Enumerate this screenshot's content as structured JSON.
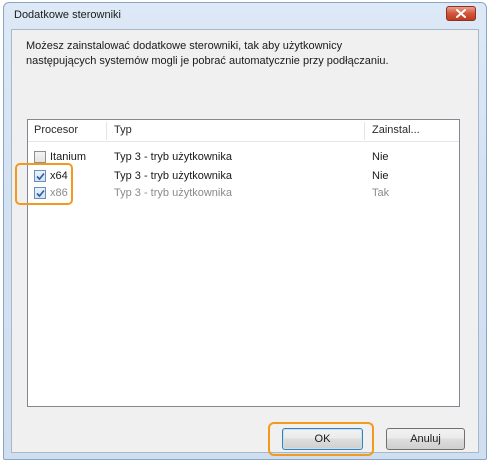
{
  "window": {
    "title": "Dodatkowe sterowniki"
  },
  "description": {
    "line1": "Możesz zainstalować dodatkowe sterowniki, tak aby użytkownicy",
    "line2": "następujących systemów mogli je pobrać automatycznie przy podłączaniu."
  },
  "table": {
    "columns": [
      "Procesor",
      "Typ",
      "Zainstal..."
    ],
    "rows": [
      {
        "processor": "Itanium",
        "type": "Typ 3 - tryb użytkownika",
        "installed": "Nie",
        "checked": false
      },
      {
        "processor": "x64",
        "type": "Typ 3 - tryb użytkownika",
        "installed": "Nie",
        "checked": true
      },
      {
        "processor": "x86",
        "type": "Typ 3 - tryb użytkownika",
        "installed": "Tak",
        "checked": true
      }
    ]
  },
  "buttons": {
    "ok": "OK",
    "cancel": "Anuluj"
  },
  "colors": {
    "highlight": "#f29a1f",
    "close": "#c94a2e"
  }
}
